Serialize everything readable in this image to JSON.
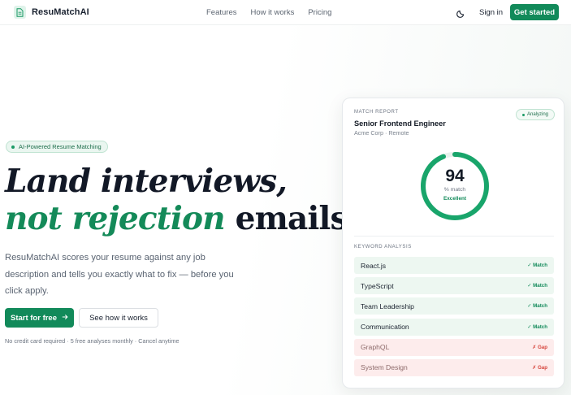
{
  "header": {
    "brand": "ResuMatchAI",
    "nav": [
      "Features",
      "How it works",
      "Pricing"
    ],
    "theme_icon": "moon-icon",
    "sign_in": "Sign in",
    "cta": "Get started"
  },
  "hero": {
    "badge": "AI-Powered Resume Matching",
    "headline_line1": "Land interviews,",
    "headline_line2_green": "not rejection",
    "headline_line2_dark": " emails.",
    "description": "ResuMatchAI scores your resume against any job description and tells you exactly what to fix — before you click apply.",
    "primary_button": "Start for free",
    "secondary_button": "See how it works",
    "fineprint": "No credit card required · 5 free analyses monthly · Cancel anytime"
  },
  "card": {
    "label": "MATCH REPORT",
    "status": "Analyzing",
    "job_title": "Senior Frontend Engineer",
    "company": "Acme Corp · Remote",
    "score": "94",
    "score_fraction": 0.94,
    "score_unit": "% match",
    "score_label": "Excellent",
    "keyword_label": "KEYWORD ANALYSIS",
    "keywords": [
      {
        "name": "React.js",
        "status": "✓ Match",
        "type": "match"
      },
      {
        "name": "TypeScript",
        "status": "✓ Match",
        "type": "match"
      },
      {
        "name": "Team Leadership",
        "status": "✓ Match",
        "type": "match"
      },
      {
        "name": "Communication",
        "status": "✓ Match",
        "type": "match"
      },
      {
        "name": "GraphQL",
        "status": "✗ Gap",
        "type": "gap"
      },
      {
        "name": "System Design",
        "status": "✗ Gap",
        "type": "gap"
      }
    ]
  },
  "colors": {
    "accent": "#128a5a",
    "gap": "#d6453c"
  }
}
